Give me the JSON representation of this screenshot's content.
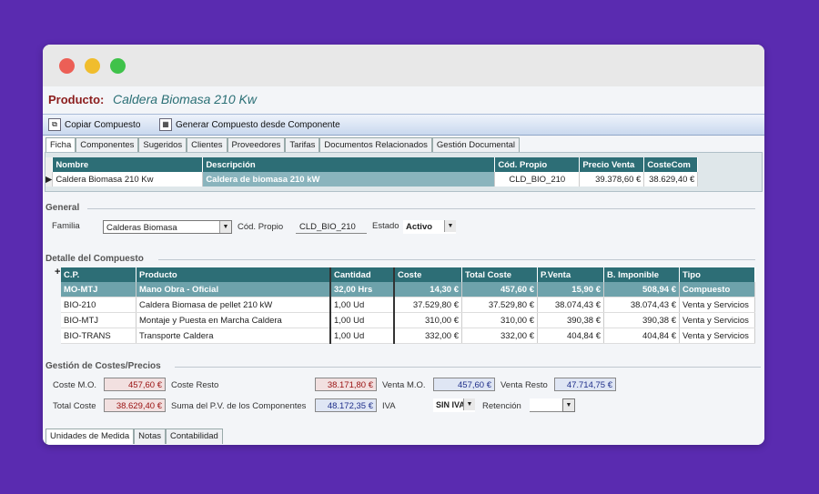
{
  "producto": {
    "label": "Producto:",
    "value": "Caldera Biomasa 210 Kw"
  },
  "toolbar": {
    "copiar": "Copiar Compuesto",
    "generar": "Generar Compuesto desde Componente"
  },
  "tabs": [
    "Ficha",
    "Componentes",
    "Sugeridos",
    "Clientes",
    "Proveedores",
    "Tarifas",
    "Documentos Relacionados",
    "Gestión Documental"
  ],
  "header_grid": {
    "columns": [
      "Nombre",
      "Descripción",
      "Cód. Propio",
      "Precio Venta",
      "CosteCom"
    ],
    "row": [
      "Caldera Biomasa 210 Kw",
      "Caldera de biomasa 210 kW",
      "CLD_BIO_210",
      "39.378,60 €",
      "38.629,40 €"
    ]
  },
  "general": {
    "title": "General",
    "familia_label": "Familia",
    "familia_value": "Calderas Biomasa",
    "cod_label": "Cód. Propio",
    "cod_value": "CLD_BIO_210",
    "estado_label": "Estado",
    "estado_value": "Activo"
  },
  "detalle": {
    "title": "Detalle del Compuesto",
    "columns": [
      "C.P.",
      "Producto",
      "Cantidad",
      "Coste",
      "Total Coste",
      "P.Venta",
      "B. Imponible",
      "Tipo"
    ],
    "rows": [
      [
        "MO-MTJ",
        "Mano Obra - Oficial",
        "32,00 Hrs",
        "14,30 €",
        "457,60 €",
        "15,90 €",
        "508,94 €",
        "Compuesto"
      ],
      [
        "BIO-210",
        "Caldera Biomasa de pellet 210 kW",
        "1,00 Ud",
        "37.529,80 €",
        "37.529,80 €",
        "38.074,43 €",
        "38.074,43 €",
        "Venta y Servicios"
      ],
      [
        "BIO-MTJ",
        "Montaje y Puesta en Marcha Caldera",
        "1,00 Ud",
        "310,00 €",
        "310,00 €",
        "390,38 €",
        "390,38 €",
        "Venta y Servicios"
      ],
      [
        "BIO-TRANS",
        "Transporte Caldera",
        "1,00 Ud",
        "332,00 €",
        "332,00 €",
        "404,84 €",
        "404,84 €",
        "Venta y Servicios"
      ]
    ]
  },
  "costes": {
    "title": "Gestión de Costes/Precios",
    "coste_mo_label": "Coste M.O.",
    "coste_mo": "457,60 €",
    "coste_resto_label": "Coste Resto",
    "coste_resto": "38.171,80 €",
    "venta_mo_label": "Venta M.O.",
    "venta_mo": "457,60 €",
    "venta_resto_label": "Venta Resto",
    "venta_resto": "47.714,75 €",
    "total_coste_label": "Total Coste",
    "total_coste": "38.629,40 €",
    "suma_pv_label": "Suma del P.V. de los Componentes",
    "suma_pv": "48.172,35 €",
    "iva_label": "IVA",
    "iva_value": "SIN IVA",
    "retencion_label": "Retención"
  },
  "bottom_tabs": [
    "Unidades de Medida",
    "Notas",
    "Contabilidad"
  ]
}
